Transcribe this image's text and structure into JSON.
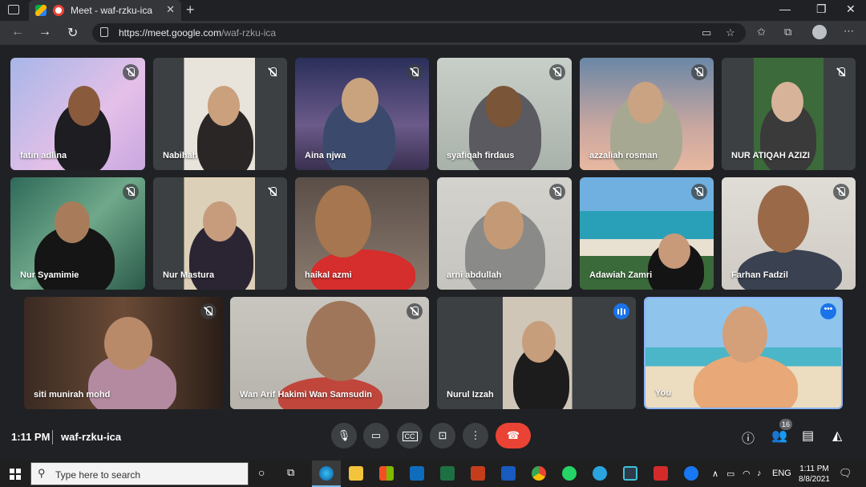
{
  "browser": {
    "tab_title": "Meet - waf-rzku-ica",
    "url_host": "https://meet.google.com",
    "url_path": "/waf-rzku-ica",
    "new_tab_icon": "plus-icon",
    "window_controls": [
      "minimize-icon",
      "maximize-icon",
      "close-icon"
    ]
  },
  "participants": [
    {
      "name": "fatin adlina",
      "status": "muted"
    },
    {
      "name": "Nabihah",
      "status": "muted"
    },
    {
      "name": "Aina njwa",
      "status": "muted"
    },
    {
      "name": "syafiqah firdaus",
      "status": "muted"
    },
    {
      "name": "azzaliah rosman",
      "status": "muted"
    },
    {
      "name": "NUR ATIQAH AZIZI",
      "status": "muted"
    },
    {
      "name": "Nur Syamimie",
      "status": "muted"
    },
    {
      "name": "Nur Mastura",
      "status": "muted"
    },
    {
      "name": "haikal azmi",
      "status": "unmuted"
    },
    {
      "name": "arni abdullah",
      "status": "muted"
    },
    {
      "name": "Adawiah Zamri",
      "status": "muted"
    },
    {
      "name": "Farhan Fadzil",
      "status": "muted"
    },
    {
      "name": "siti munirah mohd",
      "status": "muted"
    },
    {
      "name": "Wan Arif Hakimi Wan Samsudin",
      "status": "muted"
    },
    {
      "name": "Nurul Izzah",
      "status": "speaking"
    },
    {
      "name": "You",
      "status": "self"
    }
  ],
  "meeting": {
    "time": "1:11 PM",
    "code": "waf-rzku-ica",
    "participant_count": "16"
  },
  "taskbar": {
    "search_placeholder": "Type here to search",
    "language": "ENG",
    "clock_time": "1:11 PM",
    "clock_date": "8/8/2021"
  },
  "colors": {
    "meet_background": "#202124",
    "tile_background": "#3c4043",
    "end_call": "#ea4335",
    "accent": "#1a73e8"
  }
}
